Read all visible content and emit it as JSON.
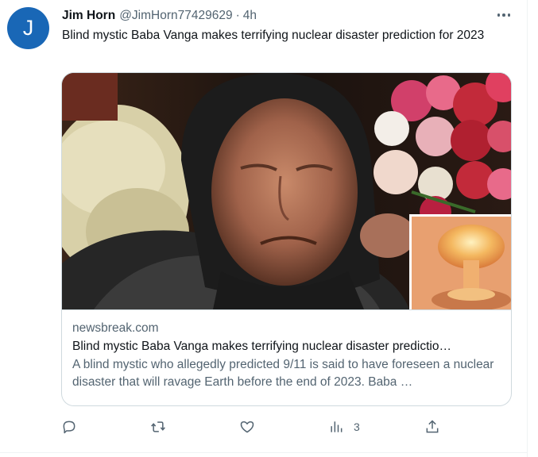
{
  "tweet": {
    "avatar_letter": "J",
    "author_name": "Jim Horn",
    "author_handle": "@JimHorn77429629",
    "separator": "·",
    "time": "4h",
    "text": "Blind mystic Baba Vanga makes terrifying nuclear disaster prediction for 2023"
  },
  "card": {
    "domain": "newsbreak.com",
    "title": "Blind mystic Baba Vanga makes terrifying nuclear disaster predictio…",
    "description": "A blind mystic who allegedly predicted 9/11 is said to have foreseen a nuclear disaster that will ravage Earth before the end of 2023. Baba …"
  },
  "actions": {
    "reply_icon": "reply-icon",
    "retweet_icon": "retweet-icon",
    "like_icon": "heart-icon",
    "views_icon": "views-icon",
    "views_count": "3",
    "share_icon": "share-icon"
  },
  "colors": {
    "avatar_bg": "#1967b6",
    "secondary_text": "#536471",
    "border": "#cfd9de"
  }
}
